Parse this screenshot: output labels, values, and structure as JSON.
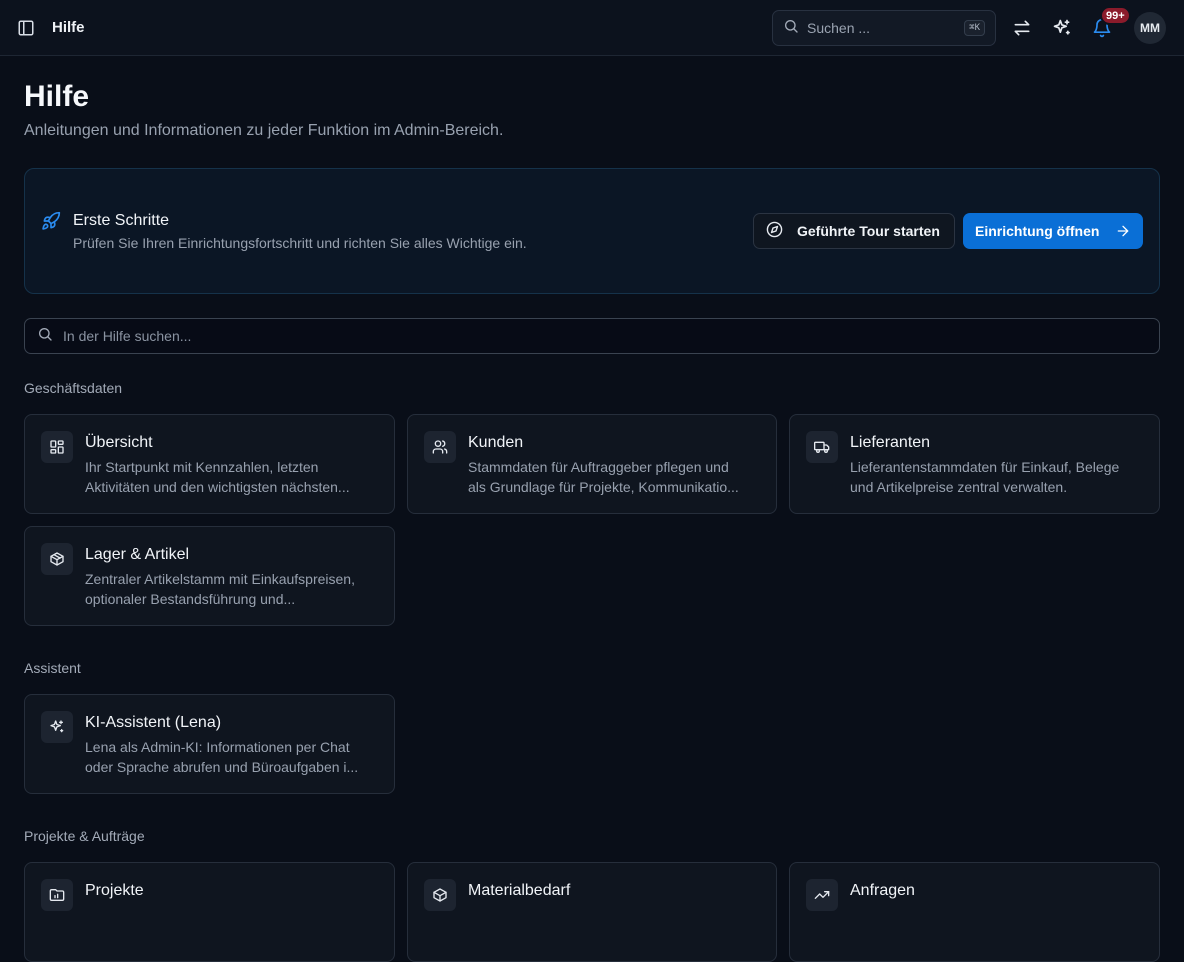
{
  "header": {
    "title": "Hilfe",
    "search_placeholder": "Suchen ...",
    "search_shortcut": "⌘K",
    "notification_count": "99+",
    "avatar_initials": "MM"
  },
  "page": {
    "title": "Hilfe",
    "subtitle": "Anleitungen und Informationen zu jeder Funktion im Admin-Bereich."
  },
  "onboarding": {
    "title": "Erste Schritte",
    "description": "Prüfen Sie Ihren Einrichtungsfortschritt und richten Sie alles Wichtige ein.",
    "tour_button": "Geführte Tour starten",
    "setup_button": "Einrichtung öffnen"
  },
  "help_search": {
    "placeholder": "In der Hilfe suchen..."
  },
  "sections": [
    {
      "title": "Geschäftsdaten",
      "cards": [
        {
          "icon": "dashboard-icon",
          "title": "Übersicht",
          "line1": "Ihr Startpunkt mit Kennzahlen, letzten",
          "line2": "Aktivitäten und den wichtigsten nächsten..."
        },
        {
          "icon": "users-icon",
          "title": "Kunden",
          "line1": "Stammdaten für Auftraggeber pflegen und",
          "line2": "als Grundlage für Projekte, Kommunikatio..."
        },
        {
          "icon": "truck-icon",
          "title": "Lieferanten",
          "line1": "Lieferantenstammdaten für Einkauf, Belege",
          "line2": "und Artikelpreise zentral verwalten."
        },
        {
          "icon": "package-icon",
          "title": "Lager & Artikel",
          "line1": "Zentraler Artikelstamm mit Einkaufspreisen,",
          "line2": "optionaler Bestandsführung und..."
        }
      ]
    },
    {
      "title": "Assistent",
      "cards": [
        {
          "icon": "sparkles-icon",
          "title": "KI-Assistent (Lena)",
          "line1": "Lena als Admin-KI: Informationen per Chat",
          "line2": "oder Sprache abrufen und Büroaufgaben i..."
        }
      ]
    },
    {
      "title": "Projekte & Aufträge",
      "cards": [
        {
          "icon": "folder-icon",
          "title": "Projekte"
        },
        {
          "icon": "package-icon",
          "title": "Materialbedarf"
        },
        {
          "icon": "trending-up-icon",
          "title": "Anfragen"
        }
      ]
    }
  ]
}
